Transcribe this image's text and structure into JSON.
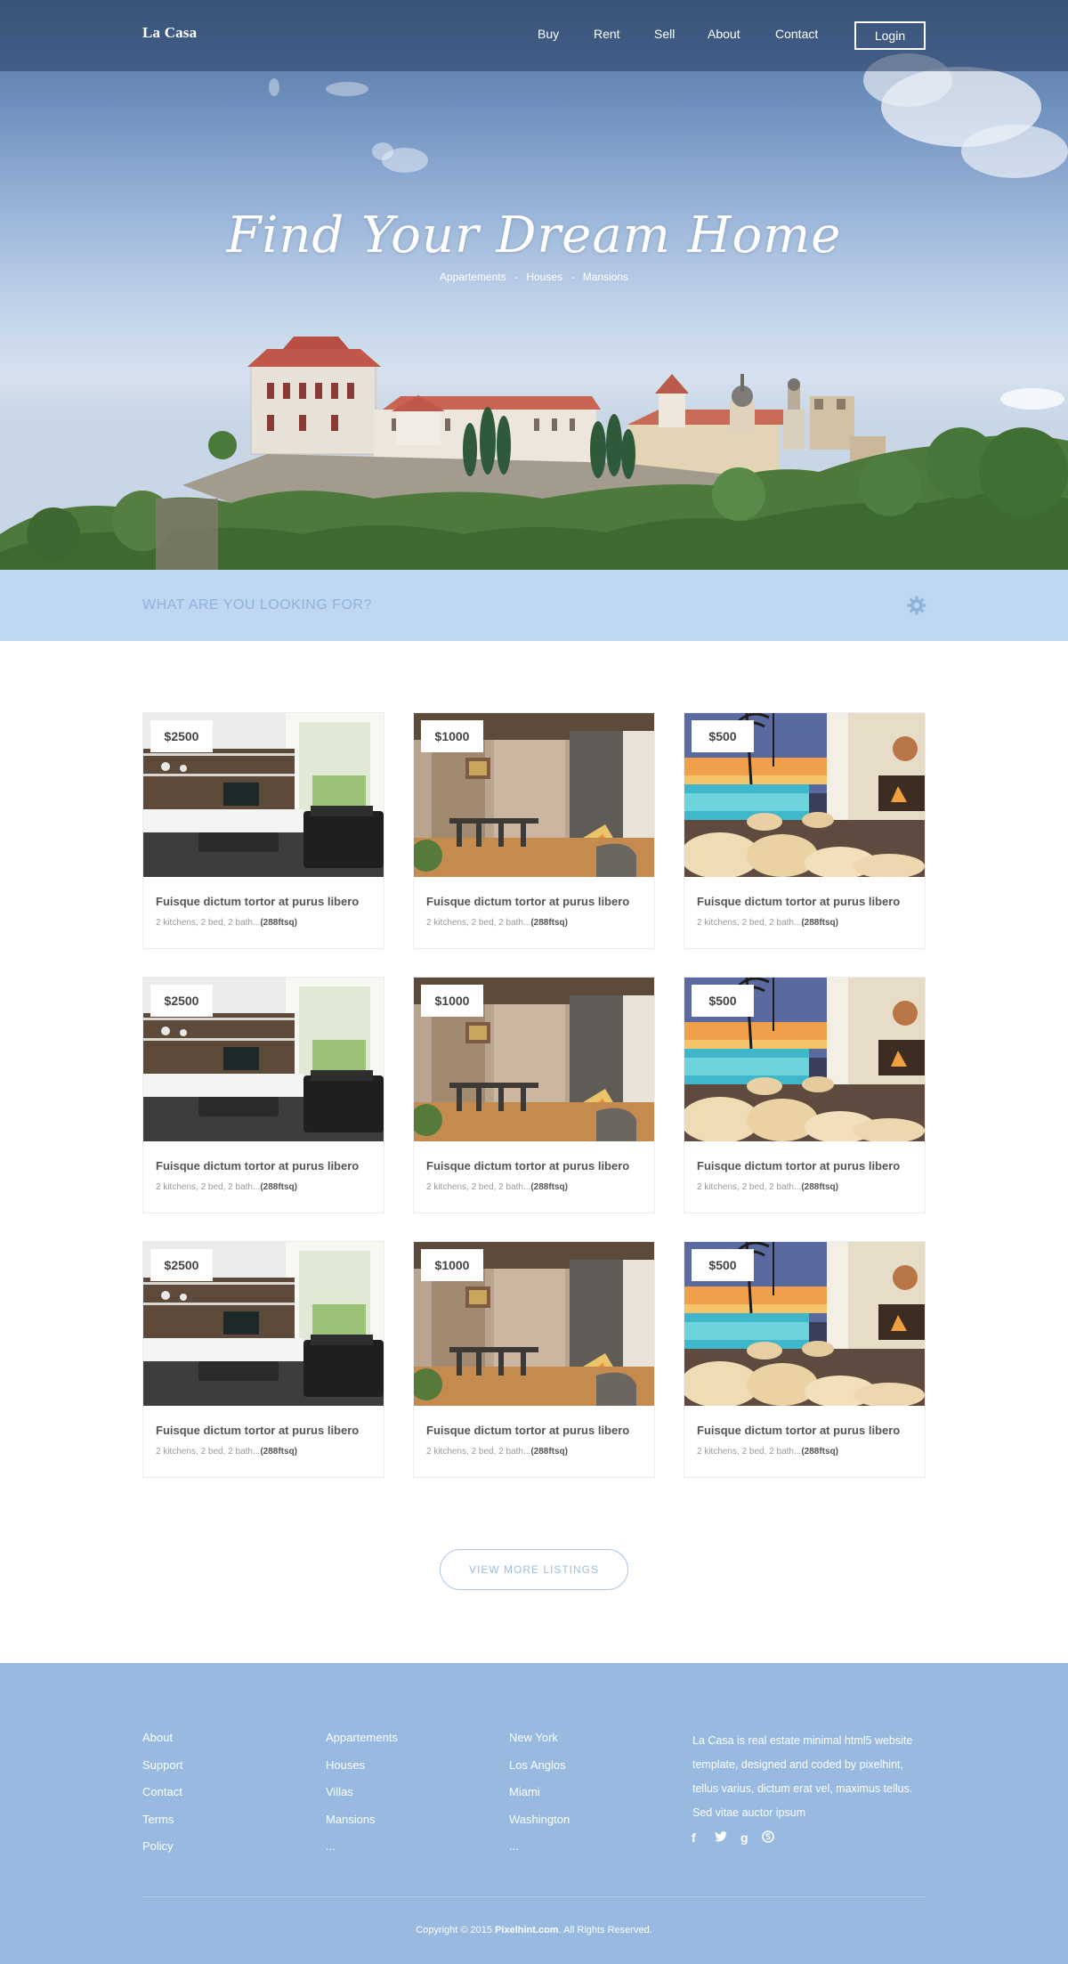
{
  "header": {
    "logo": "La Casa",
    "nav": [
      "Buy",
      "Rent",
      "Sell",
      "About",
      "Contact"
    ],
    "login_label": "Login"
  },
  "hero": {
    "title": "Find Your Dream Home",
    "subtitle_items": [
      "Appartements",
      "Houses",
      "Mansions"
    ],
    "separator": "-"
  },
  "search": {
    "placeholder": "WHAT ARE YOU LOOKING FOR?",
    "icon": "gear-icon"
  },
  "listings": [
    {
      "price": "$2500",
      "title": "Fuisque dictum tortor at purus libero",
      "meta": "2 kitchens, 2 bed, 2 bath...",
      "area": "(288ftsq)",
      "photo": "living-room"
    },
    {
      "price": "$1000",
      "title": "Fuisque dictum tortor at purus libero",
      "meta": "2 kitchens, 2 bed, 2 bath...",
      "area": "(288ftsq)",
      "photo": "dining-fireplace"
    },
    {
      "price": "$500",
      "title": "Fuisque dictum tortor at purus libero",
      "meta": "2 kitchens, 2 bed, 2 bath...",
      "area": "(288ftsq)",
      "photo": "pool-terrace"
    },
    {
      "price": "$2500",
      "title": "Fuisque dictum tortor at purus libero",
      "meta": "2 kitchens, 2 bed, 2 bath...",
      "area": "(288ftsq)",
      "photo": "living-room"
    },
    {
      "price": "$1000",
      "title": "Fuisque dictum tortor at purus libero",
      "meta": "2 kitchens, 2 bed, 2 bath...",
      "area": "(288ftsq)",
      "photo": "dining-fireplace"
    },
    {
      "price": "$500",
      "title": "Fuisque dictum tortor at purus libero",
      "meta": "2 kitchens, 2 bed, 2 bath...",
      "area": "(288ftsq)",
      "photo": "pool-terrace"
    },
    {
      "price": "$2500",
      "title": "Fuisque dictum tortor at purus libero",
      "meta": "2 kitchens, 2 bed, 2 bath...",
      "area": "(288ftsq)",
      "photo": "living-room"
    },
    {
      "price": "$1000",
      "title": "Fuisque dictum tortor at purus libero",
      "meta": "2 kitchens, 2 bed, 2 bath...",
      "area": "(288ftsq)",
      "photo": "dining-fireplace"
    },
    {
      "price": "$500",
      "title": "Fuisque dictum tortor at purus libero",
      "meta": "2 kitchens, 2 bed, 2 bath...",
      "area": "(288ftsq)",
      "photo": "pool-terrace"
    }
  ],
  "more_button": "VIEW MORE LISTINGS",
  "footer": {
    "col1": [
      "About",
      "Support",
      "Contact",
      "Terms",
      "Policy"
    ],
    "col2": [
      "Appartements",
      "Houses",
      "Villas",
      "Mansions",
      "..."
    ],
    "col3": [
      "New York",
      "Los Anglos",
      "Miami",
      "Washington",
      "..."
    ],
    "about": "La Casa is real estate minimal html5 website template, designed and coded by pixelhint, tellus varius, dictum erat vel, maximus tellus. Sed vitae auctor ipsum",
    "social": [
      {
        "icon": "facebook-icon",
        "glyph": "f"
      },
      {
        "icon": "twitter-icon",
        "glyph": "t"
      },
      {
        "icon": "google-plus-icon",
        "glyph": "g"
      },
      {
        "icon": "skype-icon",
        "glyph": "s"
      }
    ],
    "copyright_prefix": "Copyright © 2015 ",
    "copyright_brand": "Pixelhint.com",
    "copyright_suffix": ". All Rights Reserved."
  },
  "colors": {
    "accent_light": "#bfd7f1",
    "accent_text": "#8eb3dd",
    "footer_bg": "#98b9e0"
  }
}
